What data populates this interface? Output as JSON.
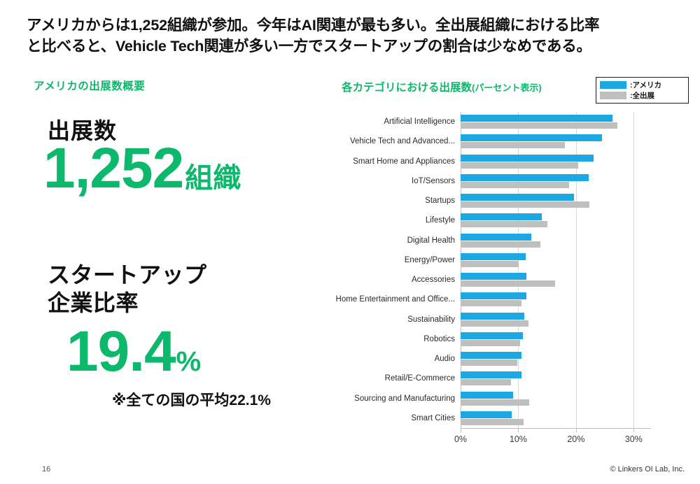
{
  "headline": {
    "line1": "アメリカからは1,252組織が参加。今年はAI関連が最も多い。全出展組織における比率",
    "line2": "と比べると、Vehicle Tech関連が多い一方でスタートアップの割合は少なめである。"
  },
  "left_panel": {
    "section_title": "アメリカの出展数概要",
    "stat1_label": "出展数",
    "stat1_value": "1,252",
    "stat1_unit": "組織",
    "stat2_label": "スタートアップ\n企業比率",
    "stat2_label_line1": "スタートアップ",
    "stat2_label_line2": "企業比率",
    "stat2_value": "19.4",
    "stat2_unit": "%",
    "stat2_note": "※全ての国の平均22.1%"
  },
  "chart_panel": {
    "section_title": "各カテゴリにおける出展数",
    "section_title_paren": "(パーセント表示)",
    "legend": [
      {
        "label": ":アメリカ",
        "color": "#1BA8E3",
        "key": "america"
      },
      {
        "label": ":全出展",
        "color": "#BFBFBF",
        "key": "all"
      }
    ]
  },
  "footer": {
    "page_number": "16",
    "copyright": "© Linkers OI Lab, Inc."
  },
  "colors": {
    "accent_green": "#0CB86B",
    "series_america": "#1BA8E3",
    "series_all": "#BFBFBF",
    "text": "#111111",
    "grid": "#D9D9D9"
  },
  "chart_data": {
    "type": "bar",
    "orientation": "horizontal",
    "title": "各カテゴリにおける出展数(パーセント表示)",
    "xlabel": "",
    "ylabel": "",
    "xlim": [
      0,
      33
    ],
    "xticks": [
      0,
      10,
      20,
      30
    ],
    "xtick_labels": [
      "0%",
      "10%",
      "20%",
      "30%"
    ],
    "grid": true,
    "legend_position": "top-right",
    "categories": [
      "Artificial Intelligence",
      "Vehicle Tech and Advanced...",
      "Smart Home and Appliances",
      "IoT/Sensors",
      "Startups",
      "Lifestyle",
      "Digital Health",
      "Energy/Power",
      "Accessories",
      "Home Entertainment and Office...",
      "Sustainability",
      "Robotics",
      "Audio",
      "Retail/E-Commerce",
      "Sourcing and Manufacturing",
      "Smart Cities"
    ],
    "series": [
      {
        "name": ":アメリカ",
        "color": "#1BA8E3",
        "values": [
          26.3,
          24.5,
          23.0,
          22.2,
          19.7,
          14.1,
          12.3,
          11.3,
          11.4,
          11.4,
          11.0,
          10.8,
          10.6,
          10.6,
          9.1,
          8.8
        ]
      },
      {
        "name": ":全出展",
        "color": "#BFBFBF",
        "values": [
          27.2,
          18.1,
          20.4,
          18.8,
          22.3,
          15.0,
          13.8,
          10.1,
          16.4,
          10.5,
          11.8,
          10.3,
          9.8,
          8.7,
          11.9,
          10.9
        ]
      }
    ]
  }
}
